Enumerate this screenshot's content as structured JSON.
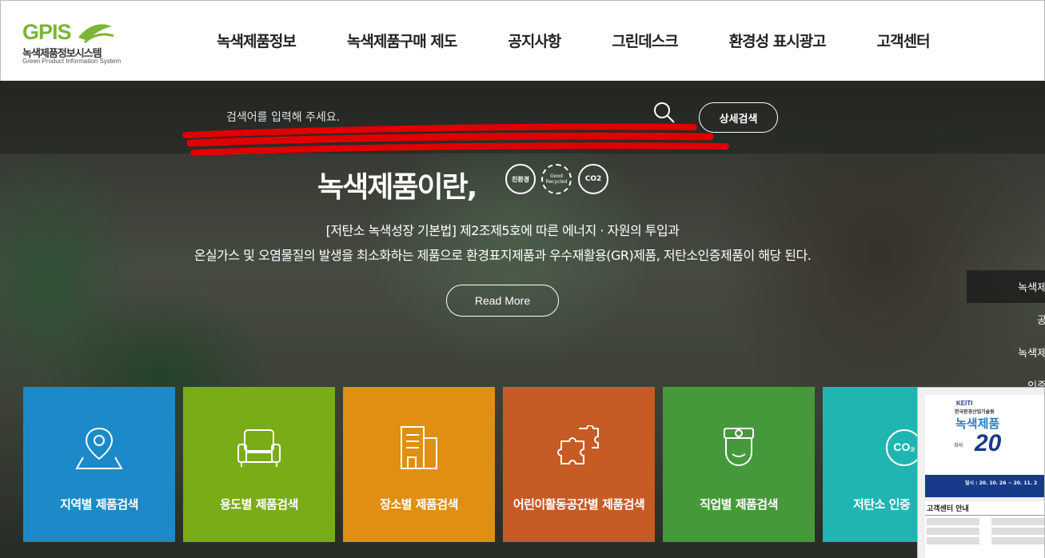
{
  "logo": {
    "mark": "GPIS",
    "title_ko": "녹색제품정보시스템",
    "title_en": "Green Product Information System"
  },
  "nav": [
    {
      "label": "녹색제품정보"
    },
    {
      "label": "녹색제품구매 제도"
    },
    {
      "label": "공지사항"
    },
    {
      "label": "그린데스크"
    },
    {
      "label": "환경성 표시광고"
    },
    {
      "label": "고객센터"
    }
  ],
  "search": {
    "placeholder": "검색어를 입력해 주세요.",
    "advanced_label": "상세검색"
  },
  "hero": {
    "title": "녹색제품이란,",
    "badges": [
      "친환경",
      "Good Recycled",
      "CO2"
    ],
    "desc_line1": "[저탄소 녹색성장 기본법] 제2조제5호에 따른 에너지 · 자원의 투입과",
    "desc_line2": "온실가스 및 오염물질의 발생을 최소화하는 제품으로 환경표지제품과 우수재활용(GR)제품, 저탄소인증제품이 해당 된다.",
    "readmore_label": "Read More"
  },
  "side_menu": [
    {
      "label": "녹색제품",
      "active": true
    },
    {
      "label": "공지",
      "active": false
    },
    {
      "label": "녹색제품",
      "active": false
    },
    {
      "label": "인증기",
      "active": false
    }
  ],
  "tiles": [
    {
      "label": "지역별 제품검색",
      "icon": "map-pin-icon",
      "color": "#1c8ac8"
    },
    {
      "label": "용도별 제품검색",
      "icon": "sofa-icon",
      "color": "#79ac17"
    },
    {
      "label": "장소별 제품검색",
      "icon": "building-icon",
      "color": "#e08f12"
    },
    {
      "label": "어린이활동공간별 제품검색",
      "icon": "puzzle-icon",
      "color": "#c65b26"
    },
    {
      "label": "직업별 제품검색",
      "icon": "worker-icon",
      "color": "#46993a"
    },
    {
      "label": "저탄소 인증",
      "icon": "co2-badge-icon",
      "color": "#21b5b2"
    }
  ],
  "popup": {
    "brand": "KEITI",
    "org": "한국환경산업기술원",
    "title": "녹색제품",
    "max": "최대",
    "percent": "20",
    "date": "일시 : 20. 10. 26 ~ 20. 11. 2",
    "section_title": "고객센터 안내"
  }
}
